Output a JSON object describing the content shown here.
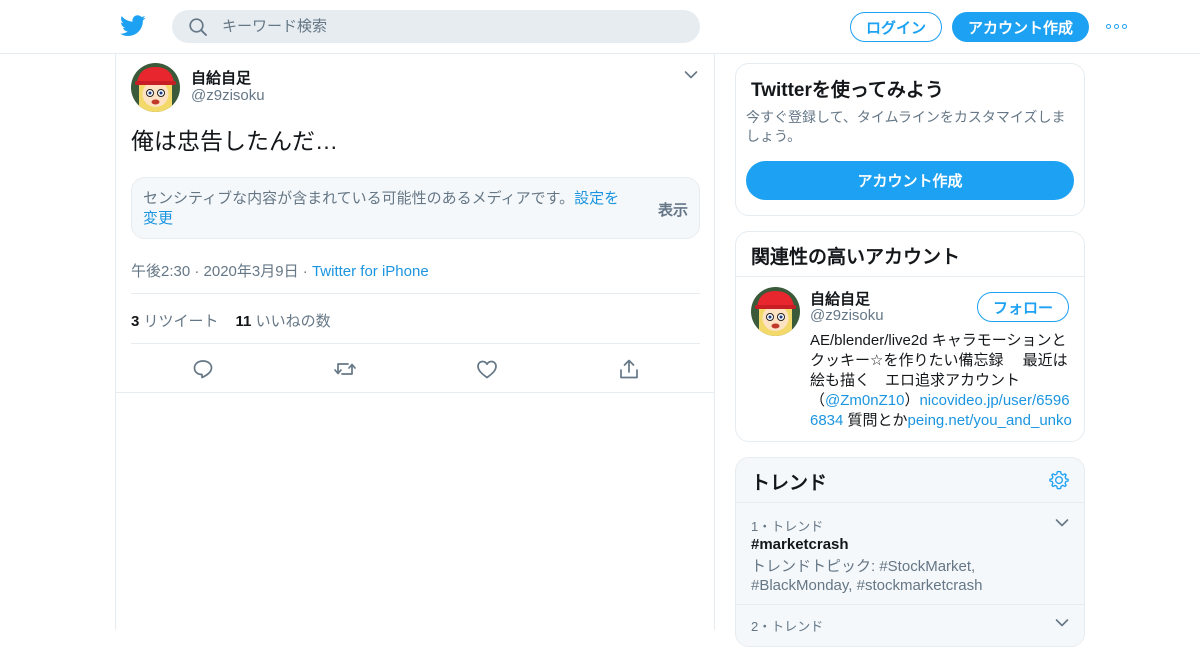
{
  "colors": {
    "accent": "#1da1f2",
    "link": "#1b95e0",
    "muted": "#657786",
    "border": "#e6ecf0",
    "panel": "#f5f8fa"
  },
  "header": {
    "search_placeholder": "キーワード検索",
    "login_label": "ログイン",
    "signup_label": "アカウント作成"
  },
  "tweet": {
    "author_name": "自給自足",
    "author_handle": "@z9zisoku",
    "text": "俺は忠告したんだ…",
    "sensitive_text": "センシティブな内容が含まれている可能性のあるメディアです。",
    "sensitive_link": "設定を変更",
    "show_label": "表示",
    "timestamp": "午後2:30 · 2020年3月9日",
    "separator": " · ",
    "source": "Twitter for iPhone",
    "retweet_count": "3",
    "retweet_label": "リツイート",
    "like_count": "11",
    "like_label": "いいねの数"
  },
  "sidebar": {
    "join": {
      "title": "Twitterを使ってみよう",
      "desc": "今すぐ登録して、タイムラインをカスタマイズしましょう。",
      "button": "アカウント作成"
    },
    "who": {
      "title": "関連性の高いアカウント",
      "name": "自給自足",
      "handle": "@z9zisoku",
      "follow": "フォロー",
      "bio_1": "AE/blender/live2d キャラモーションとクッキー☆を作りたい備忘録　 最近は絵も描く　エロ追求アカウント　（",
      "bio_link_1": "@Zm0nZ10",
      "bio_2": "）",
      "bio_link_2": "nicovideo.jp/user/65966834",
      "bio_3": " 質問とか",
      "bio_link_3": "peing.net/you_and_unko"
    },
    "trends": {
      "title": "トレンド",
      "items": [
        {
          "meta": "1・トレンド",
          "tag": "#marketcrash",
          "topics": "トレンドトピック: #StockMarket, #BlackMonday, #stockmarketcrash"
        },
        {
          "meta": "2・トレンド"
        }
      ]
    }
  }
}
